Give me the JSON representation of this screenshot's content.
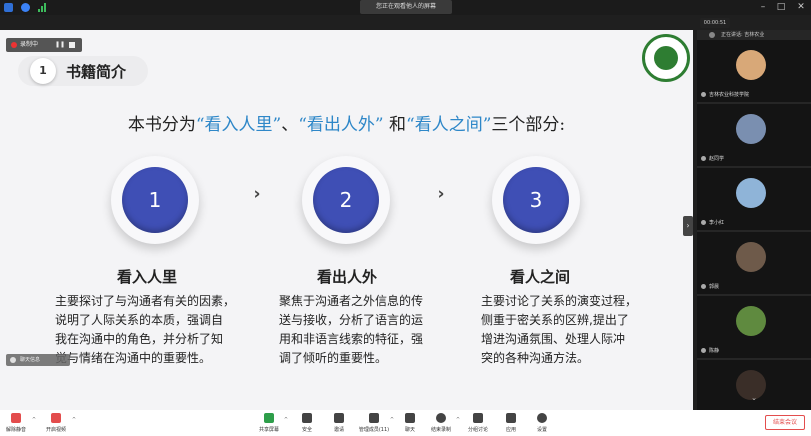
{
  "topbar": {
    "share_title": "您正在观看他人的屏幕",
    "timer": "00:00:51",
    "minimize": "–",
    "maximize": "□",
    "close": "✕"
  },
  "recording": {
    "label": "录制中",
    "pause": "❚❚"
  },
  "slide": {
    "section_number": "1",
    "section_title": "书籍简介",
    "intro": {
      "prefix": "本书分为",
      "part1": "“看入人里”",
      "sep": "、",
      "part2": "“看出人外”",
      "and": " 和",
      "part3": "“看人之间”",
      "suffix": "三个部分:"
    },
    "steps": [
      {
        "number": "1",
        "title": "看入人里",
        "lines": [
          "主要探讨了与沟通者有关的因素，",
          "说明了人际关系的本质，强调自",
          "我在沟通中的角色，并分析了知",
          "觉与情绪在沟通中的重要性。"
        ]
      },
      {
        "number": "2",
        "title": "看出人外",
        "lines": [
          "聚焦于沟通者之外信息的传",
          "送与接收，分析了语言的运",
          "用和非语言线索的特征，强",
          "调了倾听的重要性。"
        ]
      },
      {
        "number": "3",
        "title": "看人之间",
        "lines": [
          "主要讨论了关系的演变过程，",
          "侧重于密关系的区辨,提出了",
          "增进沟通氛围、处理人际冲",
          "突的各种沟通方法。"
        ]
      }
    ],
    "arrow": "›",
    "chat_popup": "聊天信息"
  },
  "panel": {
    "header": "正在讲话: 吉林农业",
    "toggle": "›",
    "more": "⌄",
    "participants": [
      {
        "name": "吉林农业科技学院",
        "color": "#d8a878"
      },
      {
        "name": "赵同学",
        "color": "#7a8fb0"
      },
      {
        "name": "李小红",
        "color": "#8fb4d8"
      },
      {
        "name": "郭晨",
        "color": "#6e5a4a"
      },
      {
        "name": "陈静",
        "color": "#5f8a3f"
      },
      {
        "name": "",
        "color": "#3a2e28"
      }
    ]
  },
  "toolbar": {
    "tools": [
      {
        "label": "解除静音",
        "icon": "microphone-icon",
        "color": "#e34d4d"
      },
      {
        "label": "开启视频",
        "icon": "camera-icon",
        "color": "#e34d4d"
      },
      {
        "label": "共享屏幕",
        "icon": "share-screen-icon",
        "color": "#2e9e4a"
      },
      {
        "label": "安全",
        "icon": "shield-icon",
        "color": "#444444"
      },
      {
        "label": "邀请",
        "icon": "invite-icon",
        "color": "#444444"
      },
      {
        "label": "管理成员(11)",
        "icon": "members-icon",
        "color": "#444444"
      },
      {
        "label": "聊天",
        "icon": "chat-icon",
        "color": "#444444"
      },
      {
        "label": "结束录制",
        "icon": "record-icon",
        "color": "#444444"
      },
      {
        "label": "分组讨论",
        "icon": "group-icon",
        "color": "#444444"
      },
      {
        "label": "应用",
        "icon": "apps-icon",
        "color": "#444444"
      },
      {
        "label": "设置",
        "icon": "gear-icon",
        "color": "#444444"
      }
    ],
    "chevron": "^",
    "end_label": "结束会议"
  }
}
